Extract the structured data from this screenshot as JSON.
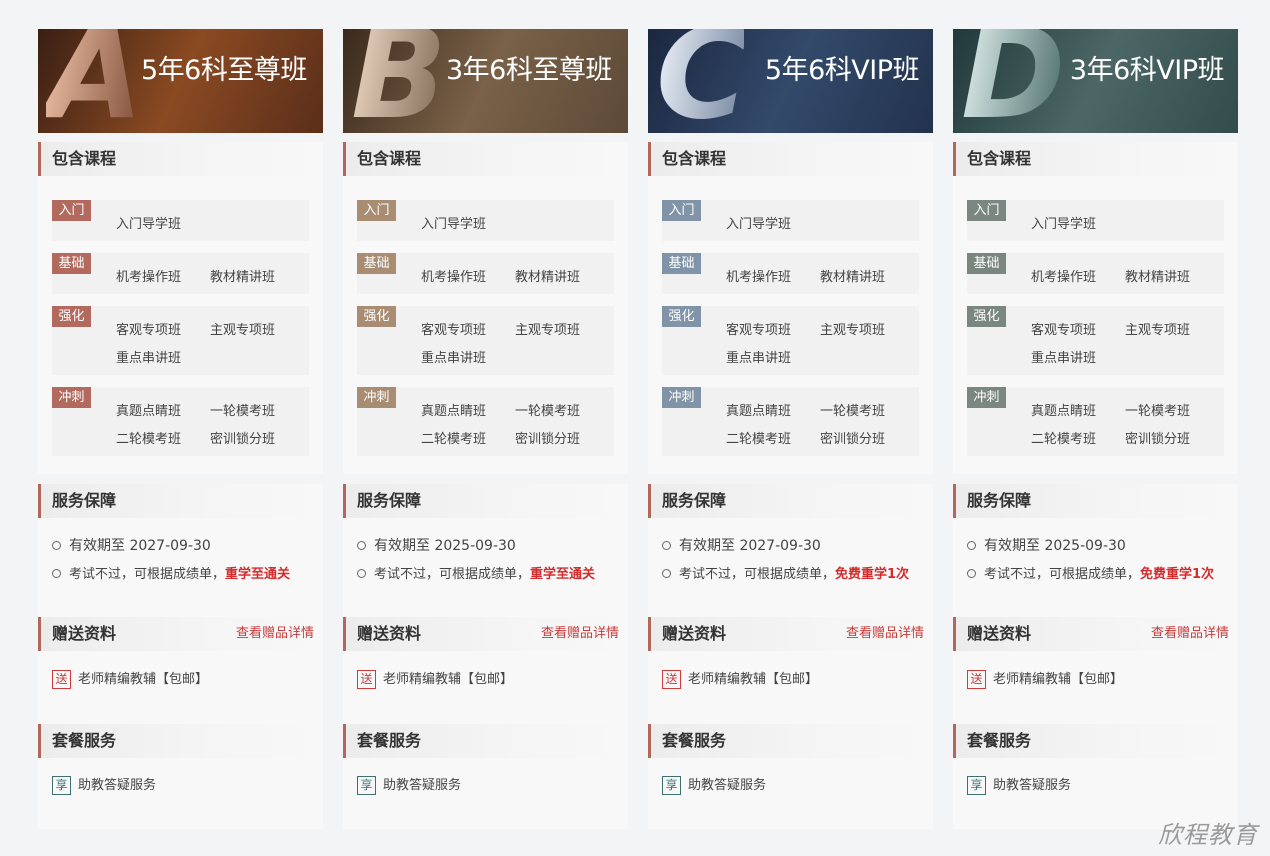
{
  "section_labels": {
    "courses": "包含课程",
    "service": "服务保障",
    "gifts": "赠送资料",
    "gift_link": "查看赠品详情",
    "package": "套餐服务"
  },
  "stage_labels": [
    "入门",
    "基础",
    "强化",
    "冲刺"
  ],
  "stage_courses": [
    [
      "入门导学班"
    ],
    [
      "机考操作班",
      "教材精讲班"
    ],
    [
      "客观专项班",
      "主观专项班",
      "重点串讲班"
    ],
    [
      "真题点睛班",
      "一轮模考班",
      "二轮模考班",
      "密训锁分班"
    ]
  ],
  "gift_icon": "送",
  "gift_item": "老师精编教辅【包邮】",
  "package_icon": "享",
  "package_item": "助教答疑服务",
  "service_text_prefix": "考试不过，可根据成绩单，",
  "plans": [
    {
      "letter": "A",
      "name": "5年6科至尊班",
      "validity": "有效期至 2027-09-30",
      "guarantee": "重学至通关",
      "badge_color": "#b36a5e",
      "banner_colors": [
        "#3a1f14",
        "#8a4a22",
        "#5a2e1a"
      ],
      "letter_colors": [
        "#e6b9a0",
        "#8c5a44"
      ]
    },
    {
      "letter": "B",
      "name": "3年6科至尊班",
      "validity": "有效期至 2025-09-30",
      "guarantee": "重学至通关",
      "badge_color": "#a88d73",
      "banner_colors": [
        "#3b2a1c",
        "#7a6148",
        "#5c4a37"
      ],
      "letter_colors": [
        "#e7d2bd",
        "#8a7460"
      ]
    },
    {
      "letter": "C",
      "name": "5年6科VIP班",
      "validity": "有效期至 2027-09-30",
      "guarantee": "免费重学1次",
      "badge_color": "#8194a7",
      "banner_colors": [
        "#1b2740",
        "#334a6b",
        "#22324d"
      ],
      "letter_colors": [
        "#e6ecf4",
        "#7e8ea6"
      ]
    },
    {
      "letter": "D",
      "name": "3年6科VIP班",
      "validity": "有效期至 2025-09-30",
      "guarantee": "免费重学1次",
      "badge_color": "#7a8680",
      "banner_colors": [
        "#22393a",
        "#4c6766",
        "#324c4c"
      ],
      "letter_colors": [
        "#d8e8e6",
        "#5a7a78"
      ]
    }
  ],
  "watermark": "欣程教育"
}
